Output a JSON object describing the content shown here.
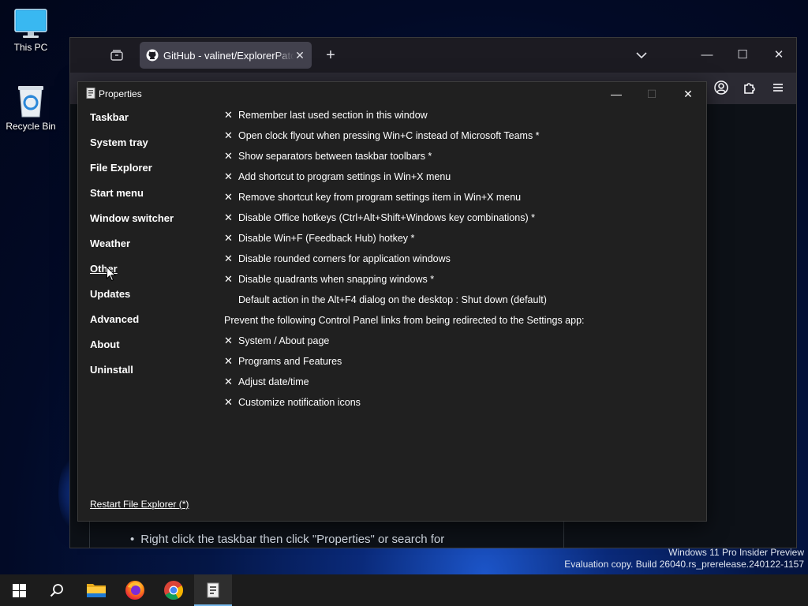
{
  "desktop": {
    "icons": [
      {
        "label": "This PC",
        "icon": "monitor-icon"
      },
      {
        "label": "Recycle Bin",
        "icon": "recycle-bin-icon"
      }
    ],
    "watermark": {
      "line1": "Windows 11 Pro Insider Preview",
      "line2": "Evaluation copy. Build 26040.rs_prerelease.240122-1157"
    }
  },
  "browser": {
    "tab": {
      "title": "GitHub - valinet/ExplorerPatcher",
      "close": "✕",
      "icon": "github-icon"
    },
    "new_tab": "+",
    "window": {
      "minimize": "—",
      "maximize": "☐",
      "close": "✕"
    },
    "page_text": "Right click the taskbar then click \"Properties\" or search for"
  },
  "properties": {
    "title": "Properties",
    "window": {
      "minimize": "—",
      "maximize": "☐",
      "close": "✕"
    },
    "sections": [
      "Taskbar",
      "System tray",
      "File Explorer",
      "Start menu",
      "Window switcher",
      "Weather",
      "Other",
      "Updates",
      "Advanced",
      "About",
      "Uninstall"
    ],
    "active_section": "Other",
    "options": [
      {
        "mark": "✕",
        "label": "Remember last used section in this window"
      },
      {
        "mark": "✕",
        "label": "Open clock flyout when pressing Win+C instead of Microsoft Teams *"
      },
      {
        "mark": "✕",
        "label": "Show separators between taskbar toolbars *"
      },
      {
        "mark": "✕",
        "label": "Add shortcut to program settings in Win+X menu"
      },
      {
        "mark": "✕",
        "label": "Remove shortcut key from program settings item in Win+X menu"
      },
      {
        "mark": "✕",
        "label": "Disable Office hotkeys (Ctrl+Alt+Shift+Windows key combinations) *"
      },
      {
        "mark": "✕",
        "label": "Disable Win+F (Feedback Hub) hotkey *"
      },
      {
        "mark": "✕",
        "label": "Disable rounded corners for application windows"
      },
      {
        "mark": "✕",
        "label": "Disable quadrants when snapping windows *"
      },
      {
        "mark": "",
        "label": "Default action in the Alt+F4 dialog on the desktop : Shut down (default)"
      },
      {
        "mark": null,
        "label": "Prevent the following Control Panel links from being redirected to the Settings app:"
      },
      {
        "mark": "✕",
        "label": "System / About page"
      },
      {
        "mark": "✕",
        "label": "Programs and Features"
      },
      {
        "mark": "✕",
        "label": "Adjust date/time"
      },
      {
        "mark": "✕",
        "label": "Customize notification icons"
      }
    ],
    "restart_link": "Restart File Explorer (*)"
  },
  "taskbar": {
    "items": [
      {
        "name": "start",
        "icon": "windows-logo-icon"
      },
      {
        "name": "search",
        "icon": "search-icon"
      },
      {
        "name": "file-explorer",
        "icon": "folder-icon"
      },
      {
        "name": "firefox",
        "icon": "firefox-icon"
      },
      {
        "name": "chrome",
        "icon": "chrome-icon"
      },
      {
        "name": "properties",
        "icon": "properties-app-icon"
      }
    ],
    "active_item": "properties"
  }
}
